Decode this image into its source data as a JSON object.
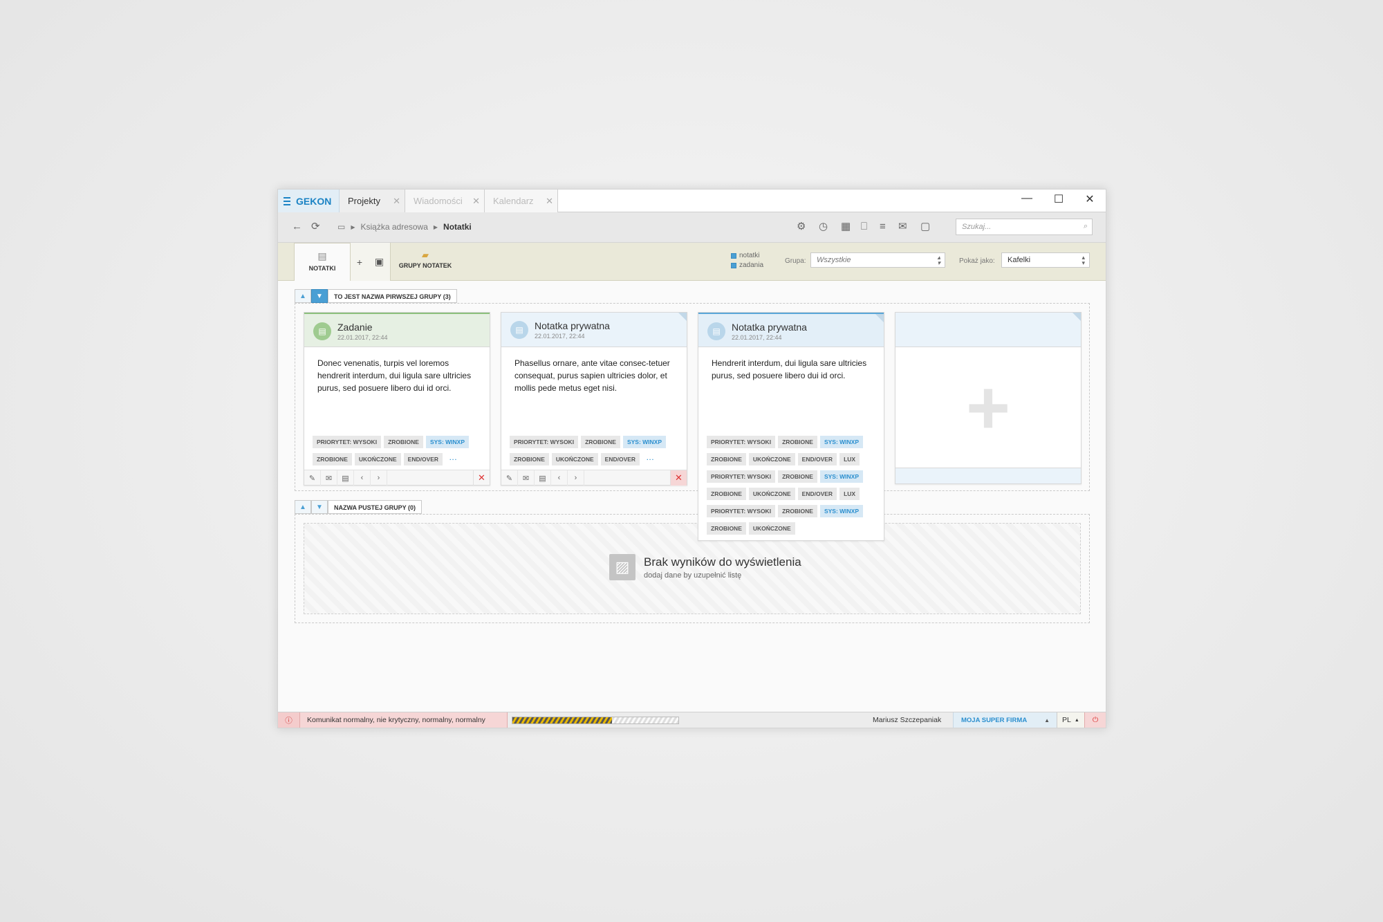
{
  "app": {
    "brand": "GEKON"
  },
  "tabs": [
    {
      "label": "Projekty"
    },
    {
      "label": "Wiadomości"
    },
    {
      "label": "Kalendarz"
    }
  ],
  "window_controls": {
    "minimize": "—",
    "maximize": "☐",
    "close": "✕"
  },
  "breadcrumb": {
    "parent": "Książka adresowa",
    "current": "Notatki"
  },
  "search": {
    "placeholder": "Szukaj..."
  },
  "ribbon": {
    "notatki_label": "NOTATKI",
    "grupy_label": "GRUPY NOTATEK",
    "filter_notatki": "notatki",
    "filter_zadania": "zadania",
    "grupa_label": "Grupa:",
    "grupa_value": "Wszystkie",
    "pokaz_label": "Pokaż jako:",
    "pokaz_value": "Kafelki"
  },
  "groups": [
    {
      "name": "TO JEST NAZWA PIRWSZEJ GRUPY (3)"
    },
    {
      "name": "NAZWA PUSTEJ GRUPY (0)"
    }
  ],
  "cards": [
    {
      "title": "Zadanie",
      "date": "22.01.2017, 22:44",
      "body": "Donec venenatis, turpis vel loremos hendrerit interdum, dui ligula sare ultricies purus, sed posuere libero dui id orci.",
      "tags": [
        "PRIORYTET: WYSOKI",
        "ZROBIONE",
        "SYS: WINXP",
        "ZROBIONE",
        "UKOŃCZONE",
        "END/OVER"
      ]
    },
    {
      "title": "Notatka prywatna",
      "date": "22.01.2017, 22:44",
      "body": "Phasellus ornare, ante vitae consec-tetuer consequat, purus sapien ultricies dolor, et mollis pede metus eget nisi.",
      "tags": [
        "PRIORYTET: WYSOKI",
        "ZROBIONE",
        "SYS: WINXP",
        "ZROBIONE",
        "UKOŃCZONE",
        "END/OVER"
      ]
    },
    {
      "title": "Notatka prywatna",
      "date": "22.01.2017, 22:44",
      "body": "Hendrerit interdum, dui ligula sare ultricies purus, sed posuere libero dui id orci.",
      "tags": [
        "PRIORYTET: WYSOKI",
        "ZROBIONE",
        "SYS: WINXP",
        "ZROBIONE",
        "UKOŃCZONE",
        "END/OVER",
        "LUX",
        "PRIORYTET: WYSOKI",
        "ZROBIONE",
        "SYS: WINXP",
        "ZROBIONE",
        "UKOŃCZONE",
        "END/OVER",
        "LUX",
        "PRIORYTET: WYSOKI",
        "ZROBIONE",
        "SYS: WINXP",
        "ZROBIONE",
        "UKOŃCZONE"
      ]
    }
  ],
  "more_tags": "···",
  "empty": {
    "title": "Brak wyników do wyświetlenia",
    "subtitle": "dodaj dane by uzupełnić listę"
  },
  "status": {
    "message": "Komunikat normalny, nie krytyczny, normalny, normalny",
    "progress": 0.6,
    "user": "Mariusz Szczepaniak",
    "company": "MOJA SUPER FIRMA",
    "lang": "PL"
  },
  "colors": {
    "accent": "#2b8fcf",
    "ribbon": "#eae9d9",
    "error_bg": "#f6d6d6"
  }
}
